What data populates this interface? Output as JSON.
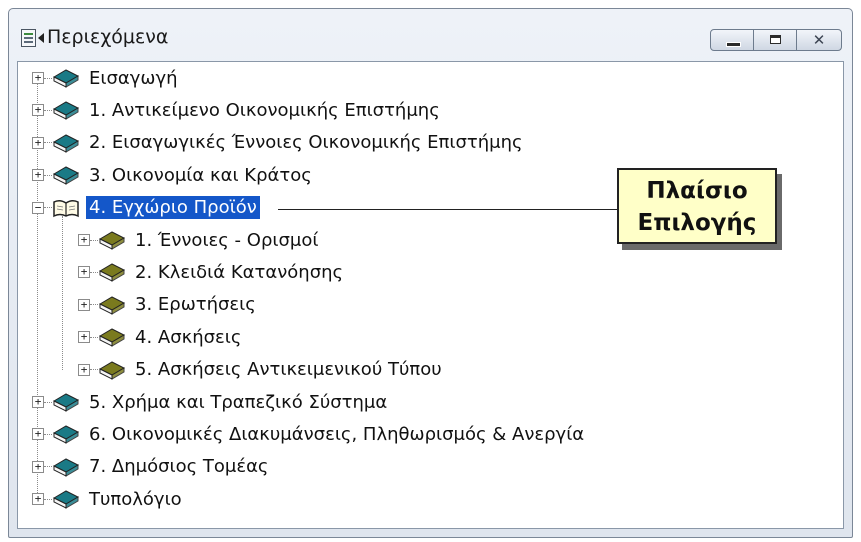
{
  "window": {
    "title": "Περιεχόμενα"
  },
  "tree": {
    "items": [
      {
        "label": "Εισαγωγή",
        "expanded": false,
        "level": 0,
        "icon": "closed-book-icon"
      },
      {
        "label": "1.  Αντικείμενο Οικονομικής Επιστήμης",
        "expanded": false,
        "level": 0,
        "icon": "closed-book-icon"
      },
      {
        "label": "2.  Εισαγωγικές Έννοιες Οικονομικής Επιστήμης",
        "expanded": false,
        "level": 0,
        "icon": "closed-book-icon"
      },
      {
        "label": "3.  Οικονομία και Κράτος",
        "expanded": false,
        "level": 0,
        "icon": "closed-book-icon"
      },
      {
        "label": "4.  Εγχώριο Προϊόν",
        "expanded": true,
        "selected": true,
        "level": 0,
        "icon": "open-book-icon"
      },
      {
        "label": "1.  Έννοιες - Ορισμοί",
        "expanded": false,
        "level": 1,
        "icon": "closed-book-icon"
      },
      {
        "label": "2.  Κλειδιά Κατανόησης",
        "expanded": false,
        "level": 1,
        "icon": "closed-book-icon"
      },
      {
        "label": "3.  Ερωτήσεις",
        "expanded": false,
        "level": 1,
        "icon": "closed-book-icon"
      },
      {
        "label": "4.  Ασκήσεις",
        "expanded": false,
        "level": 1,
        "icon": "closed-book-icon"
      },
      {
        "label": "5.  Ασκήσεις Αντικειμενικού Τύπου",
        "expanded": false,
        "level": 1,
        "icon": "closed-book-icon"
      },
      {
        "label": "5.  Χρήμα και Τραπεζικό Σύστημα",
        "expanded": false,
        "level": 0,
        "icon": "closed-book-icon"
      },
      {
        "label": "6.  Οικονομικές Διακυμάνσεις, Πληθωρισμός & Ανεργία",
        "expanded": false,
        "level": 0,
        "icon": "closed-book-icon"
      },
      {
        "label": "7.  Δημόσιος Τομέας",
        "expanded": false,
        "level": 0,
        "icon": "closed-book-icon"
      },
      {
        "label": "Τυπολόγιο",
        "expanded": false,
        "level": 0,
        "icon": "closed-book-icon"
      }
    ]
  },
  "callout": {
    "line1": "Πλαίσιο",
    "line2": "Επιλογής"
  },
  "colors": {
    "book_top_level": "#1a7a86",
    "book_child": "#7a7a1e",
    "selection": "#1457c9",
    "callout_bg": "#ffffc8"
  }
}
